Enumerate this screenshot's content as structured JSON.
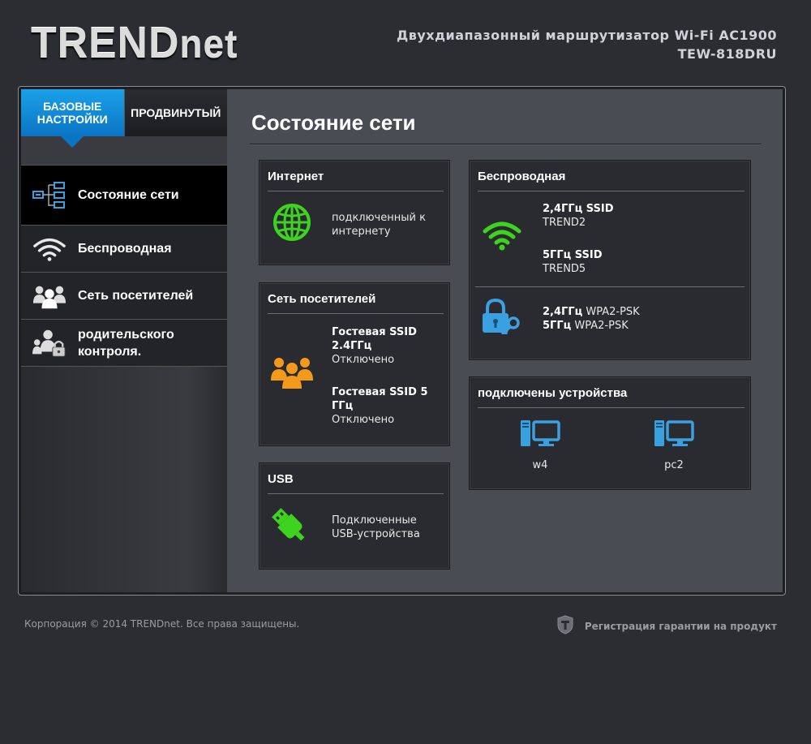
{
  "header": {
    "logo_main": "TREND",
    "logo_net": "net",
    "product_line1": "Двухдиапазонный маршрутизатор Wi-Fi AC1900",
    "product_line2": "TEW-818DRU"
  },
  "tabs": {
    "basic_line1": "Базовые",
    "basic_line2": "настройки",
    "advanced": "Продвинутый"
  },
  "sidebar": {
    "items": [
      {
        "label": "Состояние сети",
        "icon": "network-tree-icon"
      },
      {
        "label": "Беспроводная",
        "icon": "wifi-icon"
      },
      {
        "label": "Сеть посетителей",
        "icon": "guests-icon"
      },
      {
        "label_line1": "родительского",
        "label_line2": "контроля.",
        "icon": "parental-lock-icon"
      }
    ]
  },
  "main": {
    "title": "Состояние сети",
    "internet": {
      "title": "Интернет",
      "status_line1": "подключенный к",
      "status_line2": "интернету"
    },
    "guest": {
      "title": "Сеть посетителей",
      "ssid24_label_line1": "Гостевая SSID",
      "ssid24_label_line2": "2.4ГГц",
      "ssid24_status": "Отключено",
      "ssid5_label_line1": "Гостевая SSID 5",
      "ssid5_label_line2": "ГГц",
      "ssid5_status": "Отключено"
    },
    "usb": {
      "title": "USB",
      "status_line1": "Подключенные",
      "status_line2": "USB-устройства"
    },
    "wireless": {
      "title": "Беспроводная",
      "ssid24_label": "2,4ГГц SSID",
      "ssid24_value": "TREND2",
      "ssid5_label": "5ГГц SSID",
      "ssid5_value": "TREND5",
      "sec24_label": "2,4ГГц",
      "sec24_value": "WPA2-PSK",
      "sec5_label": "5ГГц",
      "sec5_value": "WPA2-PSK"
    },
    "devices": {
      "title": "подключены устройства",
      "list": [
        "w4",
        "pc2"
      ]
    }
  },
  "footer": {
    "copyright": "Корпорация © 2014 TRENDnet. Все права защищены.",
    "warranty": "Регистрация гарантии на продукт"
  },
  "colors": {
    "accent_blue": "#0a75c4",
    "status_green": "#3ed31e",
    "guest_orange": "#f39a1c",
    "device_blue": "#3aa0e0"
  }
}
